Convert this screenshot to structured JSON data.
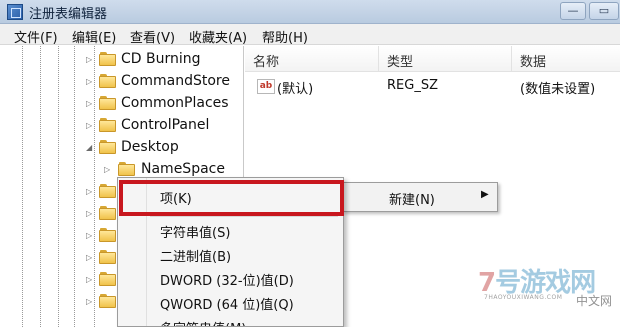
{
  "window": {
    "title": "注册表编辑器",
    "min_glyph": "—",
    "max_glyph": "▭"
  },
  "menubar": [
    {
      "label": "文件(F)"
    },
    {
      "label": "编辑(E)"
    },
    {
      "label": "查看(V)"
    },
    {
      "label": "收藏夹(A)"
    },
    {
      "label": "帮助(H)"
    }
  ],
  "tree": {
    "items": [
      {
        "label": "CD Burning",
        "expander": "▷"
      },
      {
        "label": "CommandStore",
        "expander": "▷"
      },
      {
        "label": "CommonPlaces",
        "expander": "▷"
      },
      {
        "label": "ControlPanel",
        "expander": "▷"
      },
      {
        "label": "Desktop",
        "expander": "◢"
      },
      {
        "label": "NameSpace",
        "expander": "▷"
      }
    ],
    "extra_expander": "▷"
  },
  "list": {
    "headers": {
      "name": "名称",
      "type": "类型",
      "data": "数据"
    },
    "rows": [
      {
        "icon_text": "ab",
        "name": "(默认)",
        "type": "REG_SZ",
        "data": "(数值未设置)"
      }
    ]
  },
  "context_new": {
    "label": "新建(N)",
    "arrow": "▶"
  },
  "popup": {
    "items": [
      {
        "label": "项(K)",
        "highlighted": true
      },
      {
        "label": "字符串值(S)"
      },
      {
        "label": "二进制值(B)"
      },
      {
        "label": "DWORD (32-位)值(D)"
      },
      {
        "label": "QWORD (64 位)值(Q)"
      },
      {
        "label": "多字符串值(M)"
      }
    ],
    "highlight_color": "#c8171e"
  },
  "watermark": {
    "brand_seven": "7",
    "brand_rest": "号游戏网",
    "url": "7HAOYOUXIWANG.COM",
    "cn": "中文网"
  },
  "colors": {
    "folder": "#f0c24a",
    "accent_red": "#c8171e"
  }
}
